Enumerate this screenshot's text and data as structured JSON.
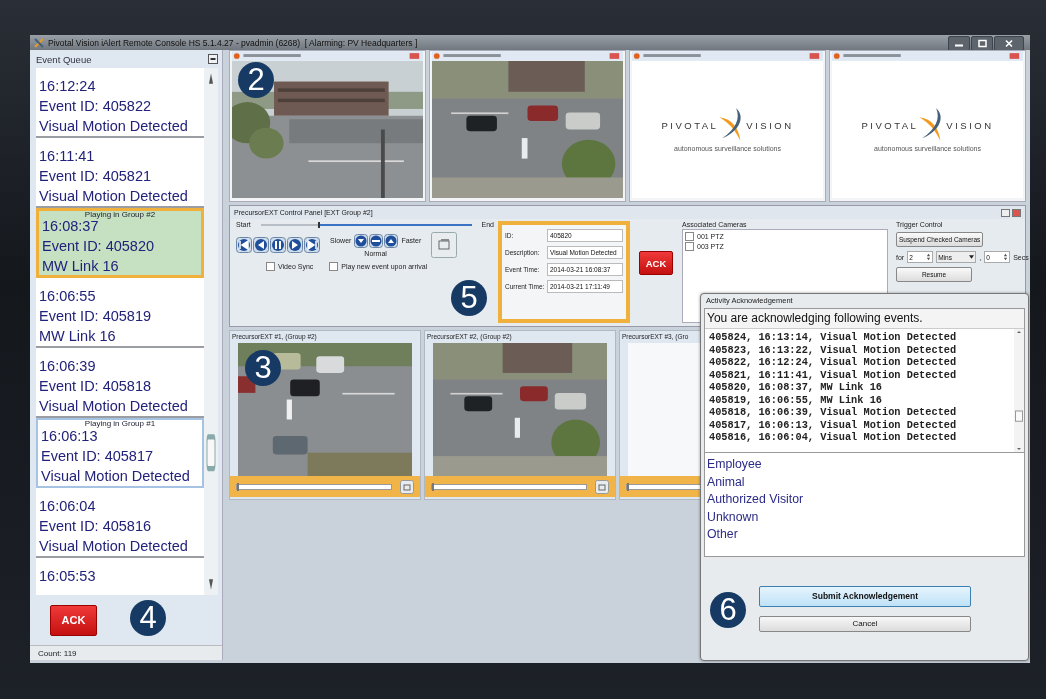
{
  "window": {
    "title": "Pivotal Vision iAlert Remote Console HS 5.1.4.27 - pvadmin (6268)  [ Alarming: PV Headquarters ]"
  },
  "event_queue": {
    "title": "Event Queue",
    "events": [
      {
        "time": "16:12:24",
        "event_id": "Event ID: 405822",
        "description": "Visual Motion Detected",
        "selected": false
      },
      {
        "time": "16:11:41",
        "event_id": "Event ID: 405821",
        "description": "Visual Motion Detected",
        "selected": false
      },
      {
        "time": "16:08:37",
        "event_id": "Event ID: 405820",
        "description": "MW Link 16",
        "selected": true,
        "playing": "Playing in Group #2"
      },
      {
        "time": "16:06:55",
        "event_id": "Event ID: 405819",
        "description": "MW Link 16",
        "selected": false
      },
      {
        "time": "16:06:39",
        "event_id": "Event ID: 405818",
        "description": "Visual Motion Detected",
        "selected": false
      },
      {
        "time": "16:06:13",
        "event_id": "Event ID: 405817",
        "description": "Visual Motion Detected",
        "selected": false,
        "playing": "Playing in Group #1"
      },
      {
        "time": "16:06:04",
        "event_id": "Event ID: 405816",
        "description": "Visual Motion Detected",
        "selected": false
      },
      {
        "time": "16:05:53",
        "selected": false
      }
    ],
    "ack_button": "ACK",
    "count": "Count: 119"
  },
  "camera_feeds": [
    {
      "kind": "video"
    },
    {
      "kind": "video"
    },
    {
      "kind": "logo",
      "logo_left": "PIVOTAL",
      "logo_right": "VISION",
      "tagline": "autonomous surveillance solutions"
    },
    {
      "kind": "logo",
      "logo_left": "PIVOTAL",
      "logo_right": "VISION",
      "tagline": "autonomous surveillance solutions"
    }
  ],
  "control_panel": {
    "title": "PrecursorEXT Control Panel [EXT Group #2]",
    "player": {
      "start": "Start",
      "end": "End",
      "level": 0.27,
      "slower": "Slower",
      "faster": "Faster",
      "normal": "Normal",
      "checkboxes": [
        {
          "label": "Video Sync",
          "checked": false
        },
        {
          "label": "Play new event upon arrival",
          "checked": false
        }
      ]
    },
    "event_info": [
      {
        "label": "ID:",
        "value": "405820"
      },
      {
        "label": "Description:",
        "value": "Visual Motion Detected"
      },
      {
        "label": "Event Time:",
        "value": "2014-03-21 16:08:37"
      },
      {
        "label": "Current Time:",
        "value": "2014-03-21 17:11:49"
      }
    ],
    "ack_button": "ACK",
    "associated_cameras": {
      "title": "Associated Cameras",
      "cameras": [
        {
          "label": "001 PTZ",
          "checked": false
        },
        {
          "label": "003 PTZ",
          "checked": false
        }
      ]
    },
    "trigger_control": {
      "title": "Trigger Control",
      "suspend_button": "Suspend Checked Cameras",
      "for_label": "for",
      "amount": "2",
      "unit": "Mins",
      "separator": ",",
      "seconds": "0",
      "seconds_label": "Secs",
      "resume_button": "Resume"
    }
  },
  "precursor_feeds": [
    {
      "title": "PrecursorEXT #1, (Group #2)",
      "kind": "video",
      "level": 0
    },
    {
      "title": "PrecursorEXT #2, (Group #2)",
      "kind": "video",
      "level": 0
    },
    {
      "title": "PrecursorEXT #3, (Gro",
      "kind": "empty",
      "level": 0
    }
  ],
  "dialog": {
    "title": "Activity Acknowledgement",
    "message": "You are acknowledging following events.",
    "events": [
      "405824, 16:13:14, Visual Motion Detected",
      "405823, 16:13:22, Visual Motion Detected",
      "405822, 16:12:24, Visual Motion Detected",
      "405821, 16:11:41, Visual Motion Detected",
      "405820, 16:08:37, MW Link 16",
      "405819, 16:06:55, MW Link 16",
      "405818, 16:06:39, Visual Motion Detected",
      "405817, 16:06:13, Visual Motion Detected",
      "405816, 16:06:04, Visual Motion Detected"
    ],
    "categories": [
      {
        "label": "Employee",
        "selected": false
      },
      {
        "label": "Animal",
        "selected": false
      },
      {
        "label": "Authorized Visitor",
        "selected": false
      },
      {
        "label": "Unknown",
        "selected": false
      },
      {
        "label": "Other",
        "selected": false
      }
    ],
    "submit_button": "Submit Acknowledgement",
    "cancel_button": "Cancel"
  },
  "callouts": [
    "2",
    "3",
    "4",
    "5",
    "6"
  ]
}
